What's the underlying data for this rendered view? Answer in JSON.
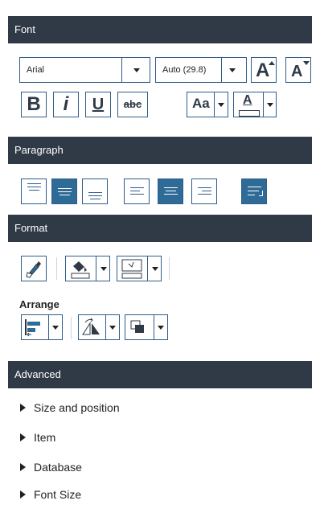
{
  "sections": {
    "font": "Font",
    "paragraph": "Paragraph",
    "format": "Format",
    "advanced": "Advanced"
  },
  "font": {
    "family": "Arial",
    "size": "Auto (29.8)",
    "bold": "B",
    "italic": "i",
    "underline": "U",
    "strike": "abc",
    "case": "Aa",
    "color_glyph": "A",
    "grow_glyph": "A",
    "shrink_glyph": "A"
  },
  "format": {
    "arrange_label": "Arrange"
  },
  "advanced": {
    "items": [
      "Size and position",
      "Item",
      "Database",
      "Font Size"
    ]
  },
  "colors": {
    "header_bg": "#2f3a46",
    "accent": "#2f6b97",
    "border": "#2f5d8a"
  },
  "icons": [
    "chevron-down-icon",
    "grow-font-icon",
    "shrink-font-icon",
    "align-top-icon",
    "align-middle-icon",
    "align-bottom-icon",
    "align-left-icon",
    "align-center-icon",
    "align-right-icon",
    "word-wrap-icon",
    "format-painter-icon",
    "fill-color-icon",
    "border-icon",
    "align-objects-icon",
    "rotate-icon",
    "order-icon",
    "expand-arrow-icon"
  ]
}
